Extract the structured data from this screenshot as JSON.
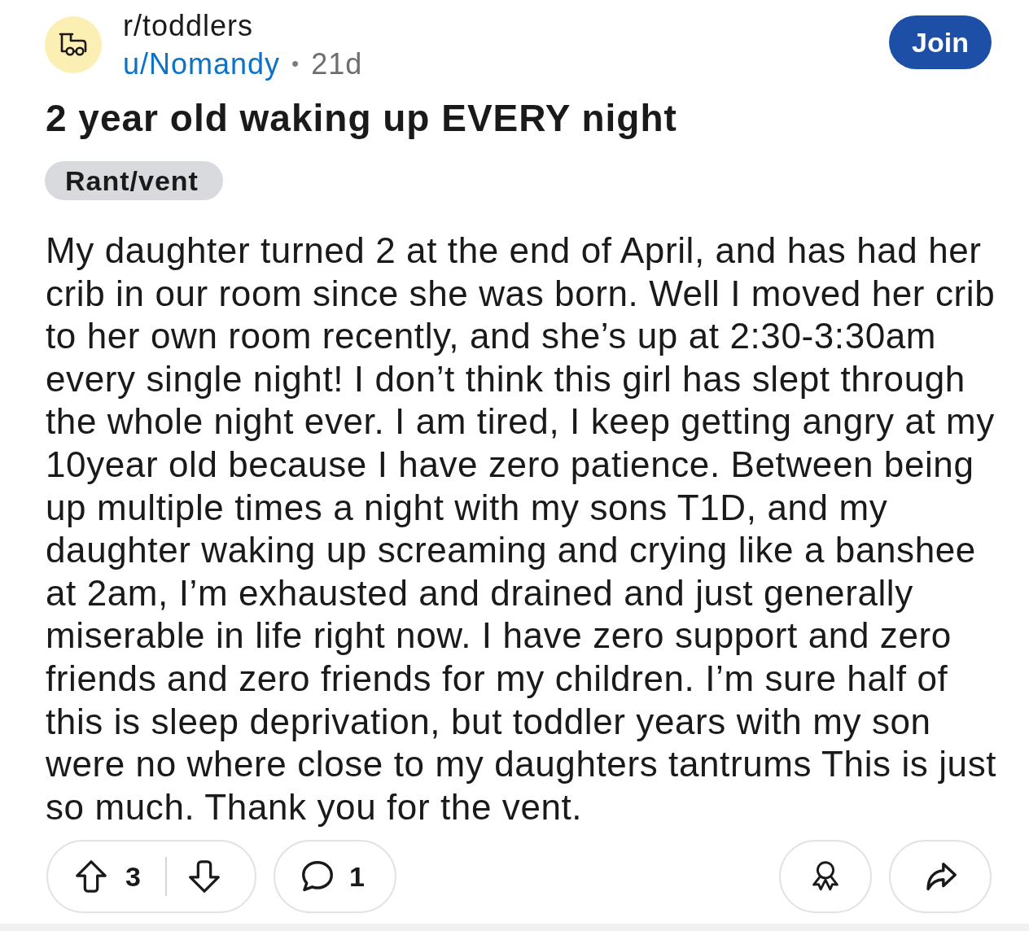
{
  "post": {
    "subreddit": "r/toddlers",
    "author": "u/Nomandy",
    "separator": "•",
    "age": "21d",
    "join_button": "Join",
    "title": "2 year old waking up EVERY night",
    "flair": "Rant/vent",
    "body": "My daughter turned 2 at the end of April, and has had her crib in our room since she was born. Well I moved her crib to her own room recently, and she’s up at 2:30-3:30am every single night! I don’t think this girl has slept through the whole night ever. I am tired, I keep getting angry at my 10year old because I have zero patience. Between being up multiple times a night with my sons T1D, and my daughter waking up screaming and crying like a banshee at 2am, I’m exhausted and drained and just generally miserable in life right now. I have zero support and zero friends and zero friends for my children. I’m sure half of this is sleep deprivation, but toddler years with my son were no where close to my daughters tantrums This is just so much. Thank you for the vent."
  },
  "actions": {
    "upvotes": "3",
    "comments": "1"
  }
}
